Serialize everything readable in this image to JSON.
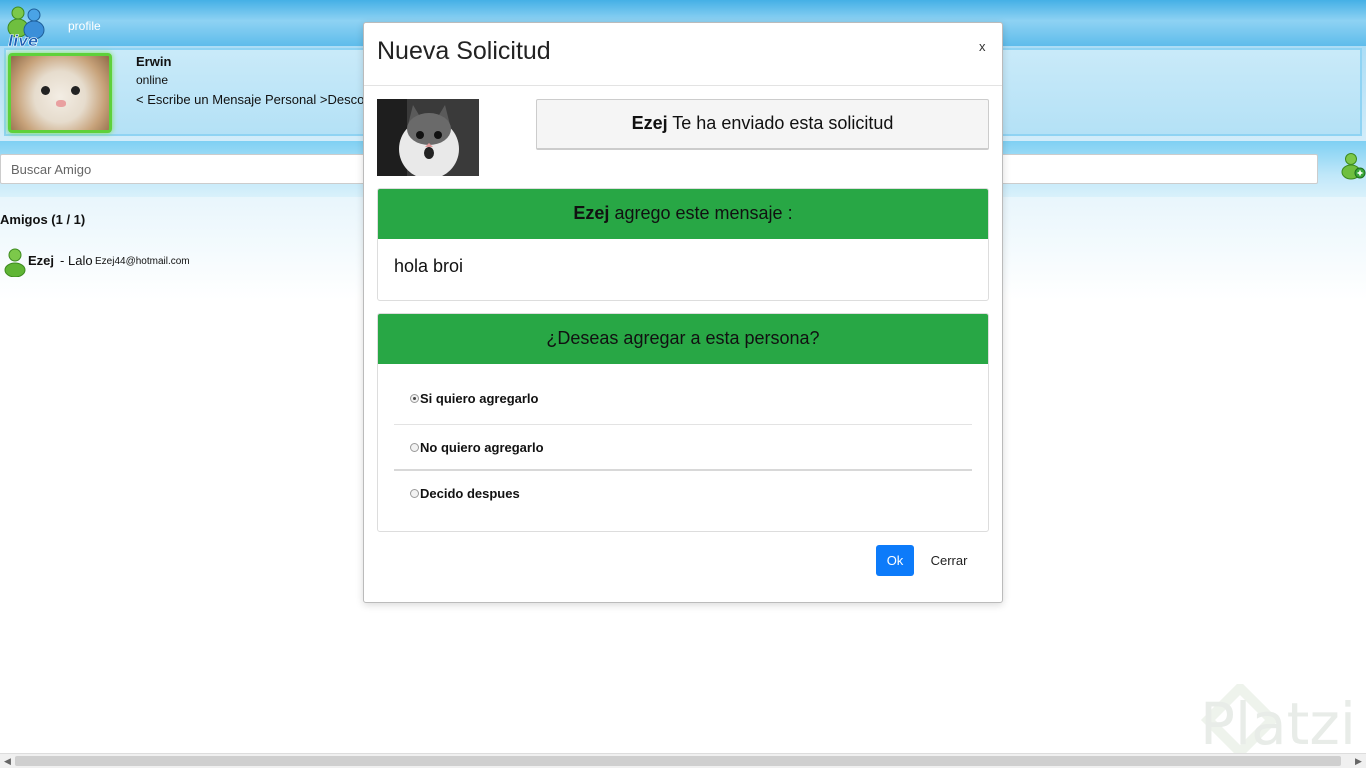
{
  "header": {
    "profile_link": "profile"
  },
  "user": {
    "name": "Erwin",
    "status": "online",
    "personal_message": "< Escribe un Mensaje Personal >Desco"
  },
  "search": {
    "placeholder": "Buscar Amigo"
  },
  "friends": {
    "header": "Amigos (1 / 1)",
    "items": [
      {
        "name": "Ezej",
        "separator": "-",
        "nickname": "Lalo",
        "email": "Ezej44@hotmail.com"
      }
    ]
  },
  "modal": {
    "title": "Nueva Solicitud",
    "close_label": "x",
    "sender_name": "Ezej",
    "sent_text": "Te ha enviado esta solicitud",
    "message_header_name": "Ezej",
    "message_header_text": "agrego este mensaje :",
    "message_body": "hola broi",
    "question": "¿Deseas agregar a esta persona?",
    "options": [
      {
        "label": "Si quiero agregarlo",
        "checked": true
      },
      {
        "label": "No quiero agregarlo",
        "checked": false
      },
      {
        "label": "Decido despues",
        "checked": false
      }
    ],
    "ok_label": "Ok",
    "cancel_label": "Cerrar"
  },
  "watermark": {
    "text": "Platzi"
  },
  "colors": {
    "header_green": "#28a745",
    "ok_blue": "#0d7bfa",
    "sky_blue": "#3aa8e0"
  }
}
